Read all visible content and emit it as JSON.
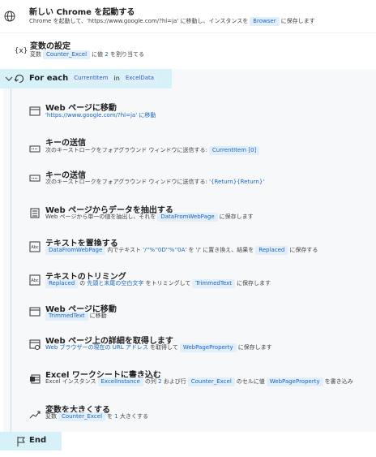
{
  "steps": {
    "s1": {
      "title": "新しい Chrome を起動する",
      "desc_pre": "Chrome を起動して、'https://www.google.com/?hl=ja' に移動し、インスタンスを",
      "var": "Browser",
      "desc_post": "に保存します"
    },
    "s2": {
      "title": "変数の設定",
      "desc_pre": "変数",
      "var": "Counter_Excel",
      "desc_mid": "に値",
      "value": "2",
      "desc_post": "を割り当てる"
    },
    "foreach": {
      "keyword": "For each",
      "item": "CurrentItem",
      "in_label": "in",
      "collection": "ExcelData"
    },
    "s3": {
      "title": "Web ページに移動",
      "desc": "'https://www.google.com/?hl=ja' に移動"
    },
    "s4": {
      "title": "キーの送信",
      "desc_pre": "次のキーストロークをフォアグラウンド ウィンドウに送信する:",
      "var": "CurrentItem [0]"
    },
    "s5": {
      "title": "キーの送信",
      "desc_pre": "次のキーストロークをフォアグラウンド ウィンドウに送信する:",
      "value": "'{Return}{Return}'"
    },
    "s6": {
      "title": "Web ページからデータを抽出する",
      "desc_pre": "Web ページから単一の値を抽出し、それを",
      "var": "DataFromWebPage",
      "desc_post": "に保存します"
    },
    "s7": {
      "title": "テキストを置換する",
      "var1": "DataFromWebPage",
      "desc_mid": "内でテキスト",
      "value": "'/''%''0D''%''0A'",
      "desc_mid2": "を '/' に置き換え、結果を",
      "var2": "Replaced",
      "desc_post": "に保存する"
    },
    "s8": {
      "title": "テキストのトリミング",
      "var1": "Replaced",
      "desc_mid": "の",
      "value": "先頭と末尾の空白文字",
      "desc_mid2": "をトリミングして",
      "var2": "TrimmedText",
      "desc_post": "に保存します"
    },
    "s9": {
      "title": "Web ページに移動",
      "var": "TrimmedText",
      "desc_post": "に移動"
    },
    "s10": {
      "title": "Web ページ上の詳細を取得します",
      "value": "Web ブラウザーの現在の URL アドレス",
      "desc_mid": "を取得して",
      "var": "WebPageProperty",
      "desc_post": "に保存します"
    },
    "s11": {
      "title": "Excel ワークシートに書き込む",
      "desc_pre": "Excel インスタンス",
      "var1": "ExcelInstance",
      "desc_mid": "の列",
      "col": "2",
      "desc_mid2": "および行",
      "var2": "Counter_Excel",
      "desc_mid3": "のセルに値",
      "var3": "WebPageProperty",
      "desc_post": "を書き込み"
    },
    "s12": {
      "title": "変数を大きくする",
      "desc_pre": "変数",
      "var": "Counter_Excel",
      "desc_mid": "を",
      "value": "1",
      "desc_post": "大きくする"
    },
    "end": {
      "label": "End"
    }
  },
  "icons": {
    "s1": "globe-icon",
    "s2": "variable-icon",
    "foreach": "loop-icon",
    "s3": "browser-window-icon",
    "s4": "keyboard-icon",
    "s5": "keyboard-icon",
    "s6": "extract-data-icon",
    "s7": "replace-text-icon",
    "s8": "trim-text-icon",
    "s9": "browser-window-icon",
    "s10": "web-details-icon",
    "s11": "excel-write-icon",
    "s12": "increase-icon",
    "end": "flag-icon"
  },
  "colors": {
    "chip_bg": "#e3eefb",
    "chip_text": "#1866c0",
    "loop_bg": "#d6f1f7"
  }
}
